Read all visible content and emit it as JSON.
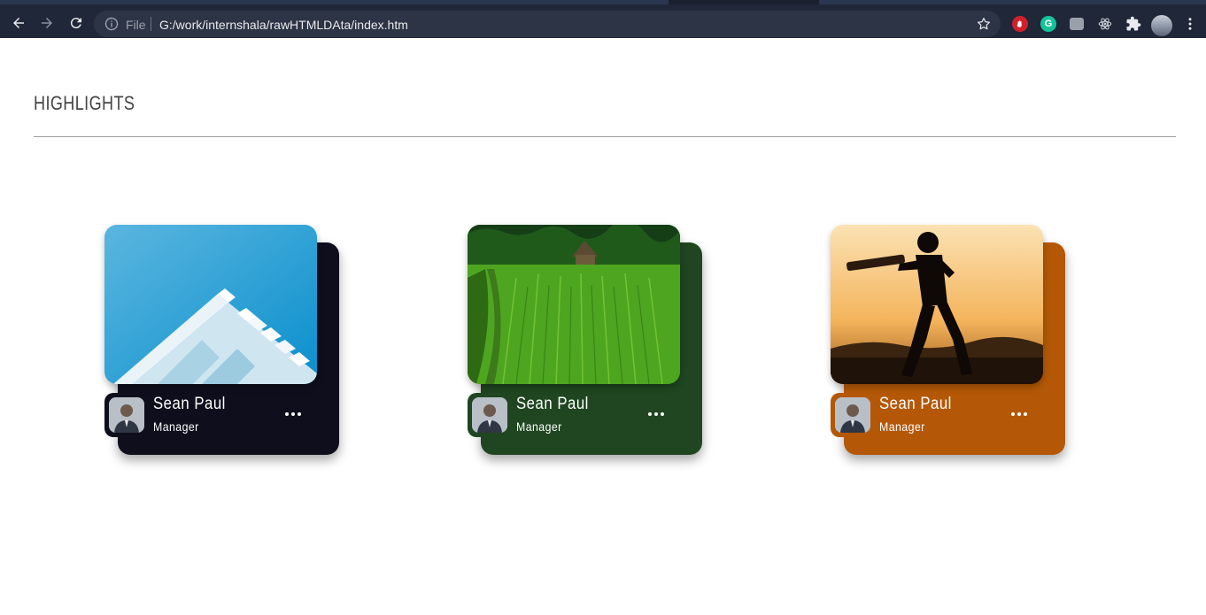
{
  "browser": {
    "url_scheme": "File",
    "url": "G:/work/internshala/rawHTMLDAta/index.htm",
    "icons": [
      "back-icon",
      "forward-icon",
      "reload-icon",
      "info-icon",
      "star-icon",
      "adblock-extension-icon",
      "grammarly-extension-icon",
      "extension-icon",
      "react-devtools-icon",
      "extensions-puzzle-icon",
      "profile-avatar",
      "kebab-menu-icon"
    ]
  },
  "page": {
    "title": "HIGHLIGHTS"
  },
  "cards": [
    {
      "name": "Sean Paul",
      "role": "Manager",
      "accent": "#0f0e1c",
      "image": "architecture-photo"
    },
    {
      "name": "Sean Paul",
      "role": "Manager",
      "accent": "#1f4620",
      "image": "rice-field-photo"
    },
    {
      "name": "Sean Paul",
      "role": "Manager",
      "accent": "#b45807",
      "image": "cricket-silhouette-photo"
    }
  ],
  "colors": {
    "browser_bar": "#202738",
    "omnibox": "#2d3446",
    "rule": "#9c9c9c"
  }
}
